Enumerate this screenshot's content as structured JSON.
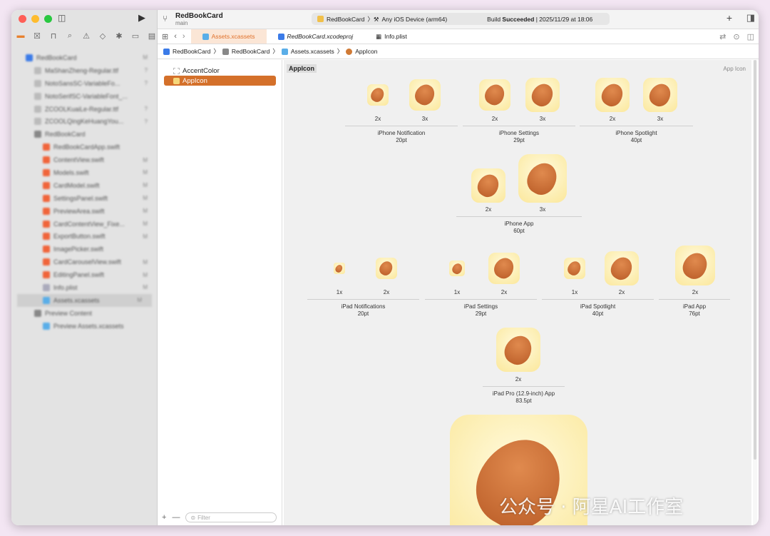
{
  "toolbar": {
    "project": "RedBookCard",
    "branch": "main",
    "scheme": "RedBookCard",
    "destination": "Any iOS Device (arm64)",
    "status_prefix": "Build ",
    "status_bold": "Succeeded",
    "status_time": "| 2025/11/29 at 18:06"
  },
  "tabs": [
    {
      "label": "Assets.xcassets"
    },
    {
      "label": "RedBookCard.xcodeproj"
    },
    {
      "label": "Info.plist"
    }
  ],
  "breadcrumb": [
    "RedBookCard",
    "RedBookCard",
    "Assets.xcassets",
    "AppIcon"
  ],
  "navigator": [
    {
      "label": "RedBookCard",
      "badge": "M"
    },
    {
      "label": "MaShanZheng-Regular.ttf",
      "badge": "?"
    },
    {
      "label": "NotoSansSC-VariableFo...",
      "badge": "?"
    },
    {
      "label": "NotoSerifSC-VariableFont_...",
      "badge": ""
    },
    {
      "label": "ZCOOLKuaiLe-Regular.ttf",
      "badge": "?"
    },
    {
      "label": "ZCOOLQingKeHuangYou...",
      "badge": "?"
    },
    {
      "label": "RedBookCard",
      "badge": ""
    },
    {
      "label": "RedBookCardApp.swift",
      "badge": ""
    },
    {
      "label": "ContentView.swift",
      "badge": "M"
    },
    {
      "label": "Models.swift",
      "badge": "M"
    },
    {
      "label": "CardModel.swift",
      "badge": "M"
    },
    {
      "label": "SettingsPanel.swift",
      "badge": "M"
    },
    {
      "label": "PreviewArea.swift",
      "badge": "M"
    },
    {
      "label": "CardContentView_Fixe...",
      "badge": "M"
    },
    {
      "label": "ExportButton.swift",
      "badge": "M"
    },
    {
      "label": "ImagePicker.swift",
      "badge": ""
    },
    {
      "label": "CardCarouselView.swift",
      "badge": "M"
    },
    {
      "label": "EditingPanel.swift",
      "badge": "M"
    },
    {
      "label": "Info.plist",
      "badge": "M"
    },
    {
      "label": "Assets.xcassets",
      "badge": "M"
    },
    {
      "label": "Preview Content",
      "badge": ""
    },
    {
      "label": "Preview Assets.xcassets",
      "badge": ""
    }
  ],
  "assets": [
    {
      "label": "AccentColor"
    },
    {
      "label": "AppIcon"
    }
  ],
  "filter_placeholder": "Filter",
  "canvas": {
    "title": "AppIcon",
    "kind": "App Icon"
  },
  "groups": [
    {
      "name": "iPhone Notification",
      "size": "20pt",
      "scales": [
        "2x",
        "3x"
      ]
    },
    {
      "name": "iPhone Settings",
      "size": "29pt",
      "scales": [
        "2x",
        "3x"
      ]
    },
    {
      "name": "iPhone Spotlight",
      "size": "40pt",
      "scales": [
        "2x",
        "3x"
      ]
    },
    {
      "name": "iPhone App",
      "size": "60pt",
      "scales": [
        "2x",
        "3x"
      ]
    },
    {
      "name": "iPad Notifications",
      "size": "20pt",
      "scales": [
        "1x",
        "2x"
      ]
    },
    {
      "name": "iPad Settings",
      "size": "29pt",
      "scales": [
        "1x",
        "2x"
      ]
    },
    {
      "name": "iPad Spotlight",
      "size": "40pt",
      "scales": [
        "1x",
        "2x"
      ]
    },
    {
      "name": "iPad App",
      "size": "76pt",
      "scales": [
        "2x"
      ]
    },
    {
      "name": "iPad Pro (12.9-inch) App",
      "size": "83.5pt",
      "scales": [
        "2x"
      ]
    }
  ],
  "watermark": "公众号 · 阿星AI工作室"
}
